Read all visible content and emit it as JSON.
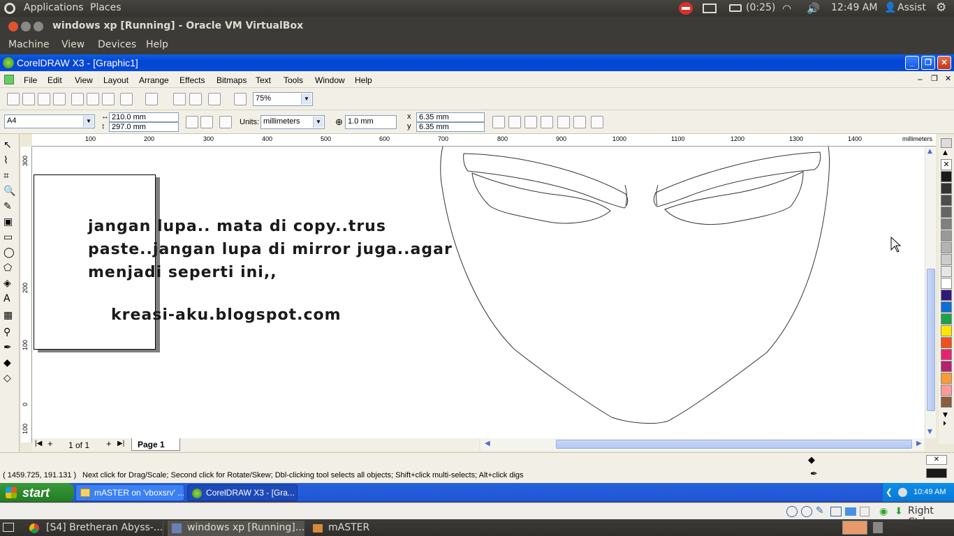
{
  "ubuntu_panel": {
    "applications": "Applications",
    "places": "Places",
    "battery": "(0:25)",
    "clock": "12:49 AM",
    "user": "Assist"
  },
  "vbox_window": {
    "title": "windows xp [Running] - Oracle VM VirtualBox",
    "menu": [
      "Machine",
      "View",
      "Devices",
      "Help"
    ]
  },
  "corel": {
    "title": "CorelDRAW X3 - [Graphic1]",
    "menu": [
      "File",
      "Edit",
      "View",
      "Layout",
      "Arrange",
      "Effects",
      "Bitmaps",
      "Text",
      "Tools",
      "Window",
      "Help"
    ],
    "zoom": "75%",
    "paper": "A4",
    "width": "210.0 mm",
    "height": "297.0 mm",
    "units_label": "Units:",
    "units": "millimeters",
    "nudge": "1.0 mm",
    "dup_x": "6.35 mm",
    "dup_y": "6.35 mm",
    "ruler_h": [
      "100",
      "200",
      "300",
      "400",
      "500",
      "600",
      "700",
      "800",
      "900",
      "1000",
      "1100",
      "1200",
      "1300",
      "1400"
    ],
    "ruler_unit": "millimeters",
    "ruler_v": [
      "300",
      "200",
      "100",
      "0",
      "100"
    ],
    "ruler_v_unit": "millimeters",
    "note_lines": [
      "jangan lupa.. mata di copy..trus",
      "paste..jangan lupa di mirror juga..agar",
      "menjadi seperti ini,,"
    ],
    "blog": "kreasi-aku.blogspot.com",
    "page_count": "1 of 1",
    "page_tab": "Page 1",
    "coords": "( 1459.725, 191.131 )",
    "status_msg": "Next click for Drag/Scale; Second click for Rotate/Skew; Dbl-clicking tool selects all objects; Shift+click multi-selects; Alt+click digs",
    "palette": [
      "#ffffff",
      "#1a1a1a",
      "#333333",
      "#4d4d4d",
      "#666666",
      "#808080",
      "#999999",
      "#b3b3b3",
      "#cccccc",
      "#e6e6e6",
      "#ffffff",
      "#2e1a7a",
      "#0a6fd6",
      "#1aa34a",
      "#ffe600",
      "#f04e1a",
      "#e6246e",
      "#b5226e",
      "#ff9933",
      "#ff9999",
      "#8c5c3c"
    ]
  },
  "xp_taskbar": {
    "start": "start",
    "tasks": [
      "mASTER on 'vboxsrv' ...",
      "CorelDRAW X3 - [Gra..."
    ],
    "clock": "10:49 AM"
  },
  "vbox_status": {
    "host_key": "Right Ctrl"
  },
  "ubuntu_bottom": {
    "tasks": [
      "[S4] Bretheran Abyss-...",
      "windows xp [Running]...",
      "mASTER"
    ]
  }
}
